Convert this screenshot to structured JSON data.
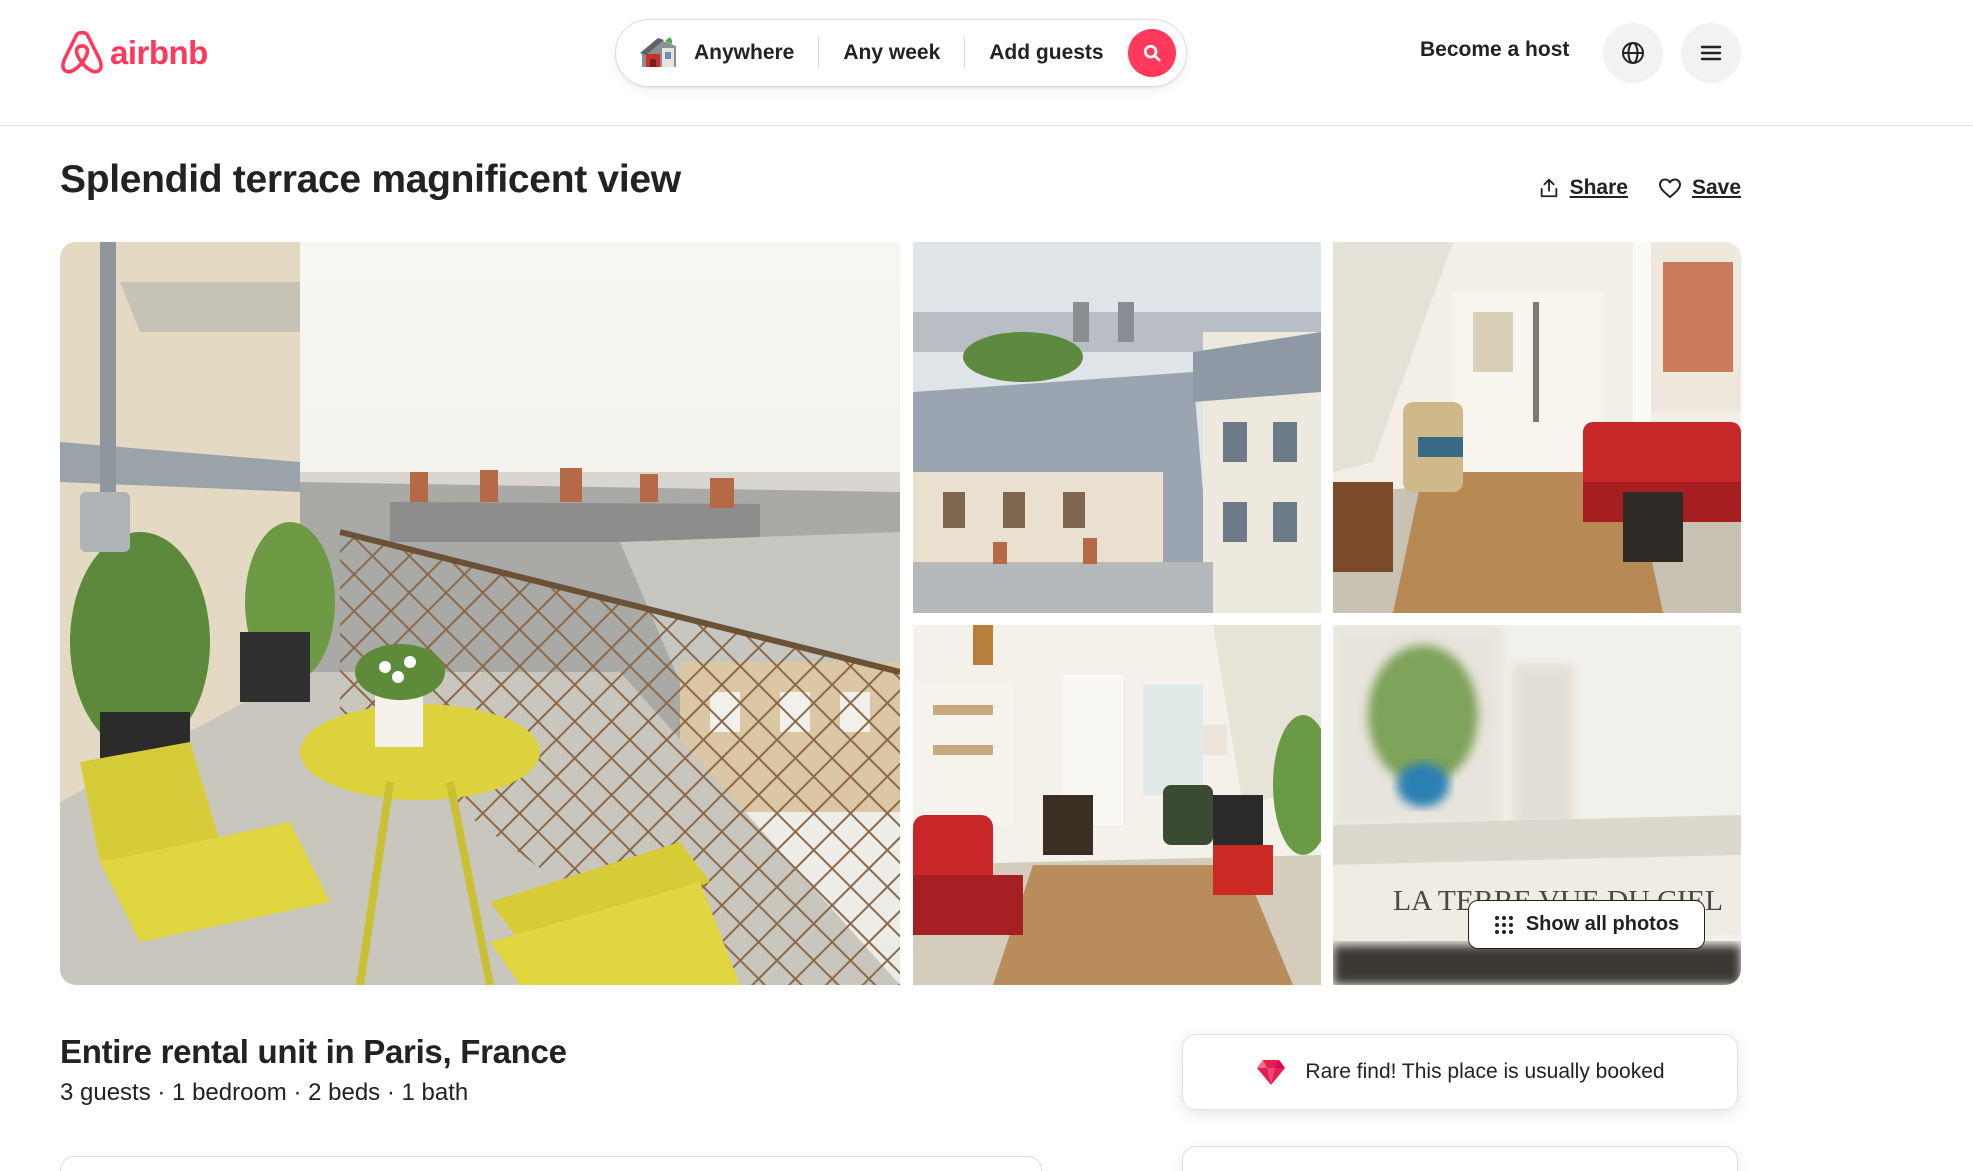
{
  "header": {
    "brand": "airbnb",
    "search": {
      "where": "Anywhere",
      "when": "Any week",
      "who": "Add guests",
      "search_icon": "search-icon"
    },
    "host_link": "Become a host",
    "globe_icon": "globe-icon",
    "menu_icon": "menu-icon"
  },
  "listing": {
    "title": "Splendid terrace magnificent view",
    "share_label": "Share",
    "save_label": "Save",
    "show_all_photos": "Show all photos",
    "type": "Entire rental unit in Paris, France",
    "details": "3 guests · 1 bedroom · 2 beds · 1 bath",
    "rare_find": "Rare find! This place is usually booked",
    "photo_overlay_text": "LA TERRE VUE DU CIEL"
  },
  "colors": {
    "brand": "#FF385C",
    "text": "#222222"
  }
}
